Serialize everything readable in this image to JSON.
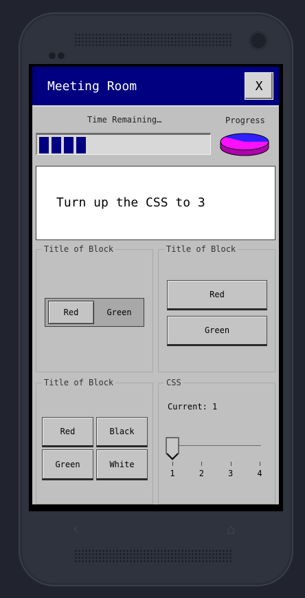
{
  "window": {
    "title": "Meeting Room",
    "close_label": "X"
  },
  "status": {
    "time_label": "Time Remaining…",
    "progress_label": "Progress",
    "time_bar_segments_filled": 4,
    "progress_pie_fraction_shown": 0.35,
    "colors": {
      "bar_fill": "#000080",
      "pie_blue": "#3020ff",
      "pie_magenta": "#ff10ff"
    }
  },
  "message": {
    "text": "Turn up the CSS to 3"
  },
  "block1": {
    "legend": "Title of Block",
    "toggle": {
      "options": [
        "Red",
        "Green"
      ],
      "selected": "Red"
    }
  },
  "block2": {
    "legend": "Title of Block",
    "buttons": [
      "Red",
      "Green"
    ]
  },
  "block3": {
    "legend": "Title of Block",
    "buttons": [
      "Red",
      "Black",
      "Green",
      "White"
    ]
  },
  "css_block": {
    "legend": "CSS",
    "current_text": "Current: 1",
    "slider": {
      "min": 1,
      "max": 4,
      "value": 1,
      "ticks": [
        "1",
        "2",
        "3",
        "4"
      ]
    }
  },
  "phone": {
    "nav_back_icon": "back-arrow-icon",
    "nav_home_icon": "home-icon"
  },
  "theme": {
    "titlebar": "#000080",
    "panel": "#c0c0c0",
    "phone_body": "#2f333e",
    "background": "#21242e"
  }
}
